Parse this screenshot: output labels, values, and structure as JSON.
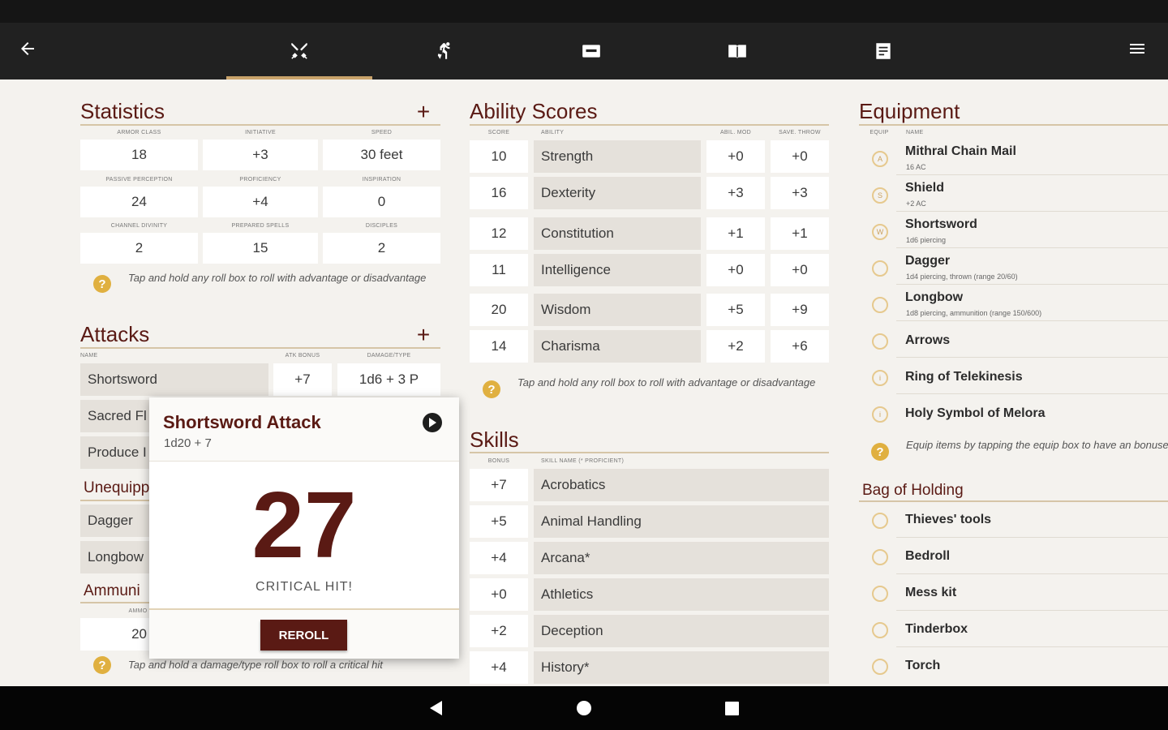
{
  "statistics": {
    "title": "Statistics",
    "rows": [
      [
        {
          "label": "Armor Class",
          "value": "18"
        },
        {
          "label": "Initiative",
          "value": "+3"
        },
        {
          "label": "Speed",
          "value": "30 feet"
        }
      ],
      [
        {
          "label": "Passive Perception",
          "value": "24"
        },
        {
          "label": "Proficiency",
          "value": "+4"
        },
        {
          "label": "Inspiration",
          "value": "0"
        }
      ],
      [
        {
          "label": "Channel Divinity",
          "value": "2"
        },
        {
          "label": "Prepared Spells",
          "value": "15"
        },
        {
          "label": "Disciples",
          "value": "2"
        }
      ]
    ],
    "hint": "Tap and hold any roll box to roll with advantage or disadvantage"
  },
  "attacks": {
    "title": "Attacks",
    "headers": {
      "name": "Name",
      "atk": "Atk Bonus",
      "dmg": "Damage/Type"
    },
    "rows": [
      {
        "name": "Shortsword",
        "atk": "+7",
        "dmg": "1d6 + 3 P"
      },
      {
        "name": "Sacred Fl"
      },
      {
        "name": "Produce I"
      }
    ],
    "unequipped_title": "Unequipp",
    "unequipped": [
      "Dagger",
      "Longbow"
    ],
    "ammo_title": "Ammuni",
    "ammo_header": "Ammo",
    "ammo_value": "20",
    "hint": "Tap and hold a damage/type roll box to roll a critical hit"
  },
  "popup": {
    "title": "Shortsword Attack",
    "formula": "1d20 + 7",
    "result": "27",
    "critical": "CRITICAL HIT!",
    "reroll": "REROLL"
  },
  "abilities": {
    "title": "Ability Scores",
    "headers": {
      "score": "Score",
      "ability": "Ability",
      "mod": "Abil. Mod",
      "save": "Save. Throw"
    },
    "rows": [
      {
        "score": "10",
        "name": "Strength",
        "mod": "+0",
        "save": "+0"
      },
      {
        "score": "16",
        "name": "Dexterity",
        "mod": "+3",
        "save": "+3"
      },
      {
        "score": "12",
        "name": "Constitution",
        "mod": "+1",
        "save": "+1"
      },
      {
        "score": "11",
        "name": "Intelligence",
        "mod": "+0",
        "save": "+0"
      },
      {
        "score": "20",
        "name": "Wisdom",
        "mod": "+5",
        "save": "+9"
      },
      {
        "score": "14",
        "name": "Charisma",
        "mod": "+2",
        "save": "+6"
      }
    ],
    "hint": "Tap and hold any roll box to roll with advantage or disadvantage"
  },
  "skills": {
    "title": "Skills",
    "headers": {
      "bonus": "Bonus",
      "name": "Skill Name (* Proficient)"
    },
    "rows": [
      {
        "bonus": "+7",
        "name": "Acrobatics"
      },
      {
        "bonus": "+5",
        "name": "Animal Handling"
      },
      {
        "bonus": "+4",
        "name": "Arcana*"
      },
      {
        "bonus": "+0",
        "name": "Athletics"
      },
      {
        "bonus": "+2",
        "name": "Deception"
      },
      {
        "bonus": "+4",
        "name": "History*"
      }
    ]
  },
  "equipment": {
    "title": "Equipment",
    "headers": {
      "equip": "Equip",
      "name": "Name"
    },
    "items": [
      {
        "name": "Mithral Chain Mail",
        "sub": "16 AC",
        "glyph": "A"
      },
      {
        "name": "Shield",
        "sub": "+2 AC",
        "glyph": "S"
      },
      {
        "name": "Shortsword",
        "sub": "1d6 piercing",
        "glyph": "W"
      },
      {
        "name": "Dagger",
        "sub": "1d4 piercing, thrown (range 20/60)",
        "glyph": ""
      },
      {
        "name": "Longbow",
        "sub": "1d8 piercing, ammunition (range 150/600)",
        "glyph": ""
      },
      {
        "name": "Arrows",
        "sub": "",
        "glyph": ""
      },
      {
        "name": "Ring of Telekinesis",
        "sub": "",
        "glyph": "i"
      },
      {
        "name": "Holy Symbol of Melora",
        "sub": "",
        "glyph": "i"
      }
    ],
    "hint": "Equip items by tapping the equip box to have an bonuses activated",
    "bag_title": "Bag of Holding",
    "bag_items": [
      "Thieves' tools",
      "Bedroll",
      "Mess kit",
      "Tinderbox",
      "Torch"
    ]
  },
  "colors": {
    "accent": "#5a1a14",
    "gold": "#c9a36b",
    "appbar": "#212121"
  }
}
